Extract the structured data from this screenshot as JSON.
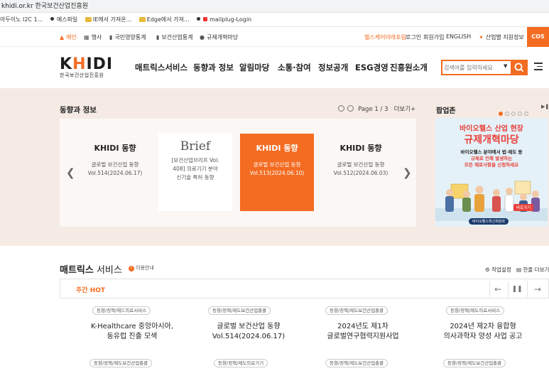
{
  "browser": {
    "url_host": "khidi.or.kr",
    "tab_title": "한국보건산업진흥원",
    "bookmarks": [
      "아두이노 I2C 1...",
      "예스파일",
      "IE에서 가져온...",
      "Edge에서 가져...",
      "mailplug-Login"
    ]
  },
  "util_bar": {
    "items": [
      "메인",
      "행사",
      "국민영양통계",
      "보건산업통계",
      "규제개혁마당"
    ],
    "right_links": [
      "헬스케어미래포럼",
      "로그인",
      "회원가입",
      "ENGLISH",
      "산업별 지원정보"
    ],
    "cos_label": "COS"
  },
  "header": {
    "logo_text": "KHIDI",
    "logo_sub": "한국보건산업진흥원",
    "nav": [
      "매트릭스서비스",
      "동향과 정보",
      "알림마당",
      "소통·참여",
      "정보공개",
      "ESG경영",
      "진흥원소개"
    ],
    "search_placeholder": "검색어를 입력하세요"
  },
  "trends": {
    "title": "동향과 정보",
    "page_label": "Page",
    "page_value": "1 / 3",
    "more_label": "더보기",
    "cards": [
      {
        "brand": "KHIDI 동향",
        "text1": "글로벌 보건산업 동향",
        "text2": "Vol.514(2024.06.17)"
      },
      {
        "brand": "Brief",
        "text1": "[보건산업브리프 Vol.",
        "text2": "408] 의료기기 분야",
        "text3": "신기술 특허 동향"
      },
      {
        "brand": "KHIDI 동향",
        "text1": "글로벌 보건산업 동향",
        "text2": "Vol.513(2024.06.10)"
      },
      {
        "brand": "KHIDI 동향",
        "text1": "글로벌 보건산업 동향",
        "text2": "Vol.512(2024.06.03)"
      }
    ]
  },
  "popup": {
    "title": "팝업존",
    "banner_line1": "바이오헬스 산업 현장",
    "banner_line2": "규제개혁마당",
    "banner_line3a": "바이오헬스 분야에서 법·제도 등",
    "banner_line3b": "규제로 인해 발생하는",
    "banner_line3c": "모든 애로사항을 신청하세요",
    "banner_more": "바로가기",
    "banner_foot": "바이오헬스혁신위원회"
  },
  "matrix": {
    "title_bold": "매트릭스",
    "title_rest": " 서비스",
    "guide": "이용안내",
    "settings_label": "작업설정",
    "expand_label": "한줄 더보기",
    "hot_label": "주간 HOT",
    "items": [
      {
        "tag": "동향/정책/헤드의료서비스",
        "line1": "K-Healthcare 중앙아시아,",
        "line2": "동유럽 진출 모색"
      },
      {
        "tag": "동향/정책/제도보건산업총괄",
        "line1": "글로벌 보건산업 동향",
        "line2": "Vol.514(2024.06.17)"
      },
      {
        "tag": "동향/정책/제도보건산업총괄",
        "line1": "2024년도 제1차",
        "line2": "글로벌연구협력지원사업"
      },
      {
        "tag": "동향/정책/제도의료서비스",
        "line1": "2024년 제2차 융합형",
        "line2": "의사과학자 양성 사업 공고"
      }
    ],
    "row2_tags": [
      "동향/정책/제도보건산업총괄",
      "동향/정책/제도의료기기",
      "동향/정책/제도보건산업총괄",
      "동향/정책/제도보건산업총괄"
    ]
  }
}
